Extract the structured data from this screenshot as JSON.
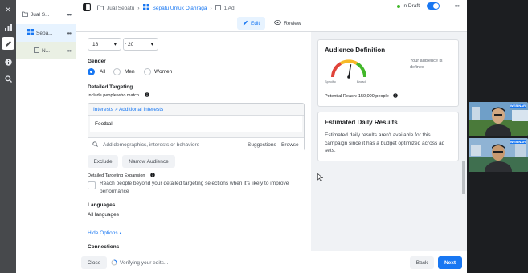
{
  "tree": {
    "items": [
      {
        "label": "Jual S..."
      },
      {
        "label": "Sepa..."
      },
      {
        "label": "N..."
      }
    ]
  },
  "breadcrumb": {
    "campaign": "Jual Sepatu",
    "adset": "Sepatu Untuk Olahraga",
    "ad": "1 Ad"
  },
  "status": {
    "draft_label": "In Draft"
  },
  "tabs": {
    "edit": "Edit",
    "review": "Review"
  },
  "age": {
    "min": "18",
    "max": "20"
  },
  "gender": {
    "title": "Gender",
    "options": [
      "All",
      "Men",
      "Women"
    ],
    "selected": "All"
  },
  "targeting": {
    "title": "Detailed Targeting",
    "subtitle": "Include people who match",
    "path": "Interests > Additional Interests",
    "chip": "Football",
    "search_placeholder": "Add demographics, interests or behaviors",
    "suggestions": "Suggestions",
    "browse": "Browse",
    "exclude": "Exclude",
    "narrow": "Narrow Audience",
    "expansion_title": "Detailed Targeting Expansion",
    "expansion_text": "Reach people beyond your detailed targeting selections when it's likely to improve performance"
  },
  "languages": {
    "title": "Languages",
    "value": "All languages"
  },
  "hide_options": "Hide Options",
  "connections": "Connections",
  "audience": {
    "title": "Audience Definition",
    "note": "Your audience is defined",
    "specific": "Specific",
    "broad": "Broad",
    "potential_reach": "Potential Reach: 150,000 people",
    "gauge_value": 0.55
  },
  "results": {
    "title": "Estimated Daily Results",
    "text": "Estimated daily results aren't available for this campaign since it has a budget optimized across ad sets."
  },
  "bottom": {
    "close": "Close",
    "verifying": "Verifying your edits...",
    "back": "Back",
    "next": "Next"
  },
  "video": {
    "badge": "WEBINAR"
  },
  "colors": {
    "accent": "#1877f2",
    "rail": "#47494c",
    "draft_dot": "#42b72a",
    "gauge_red": "#e0443a",
    "gauge_green": "#42b72a"
  }
}
